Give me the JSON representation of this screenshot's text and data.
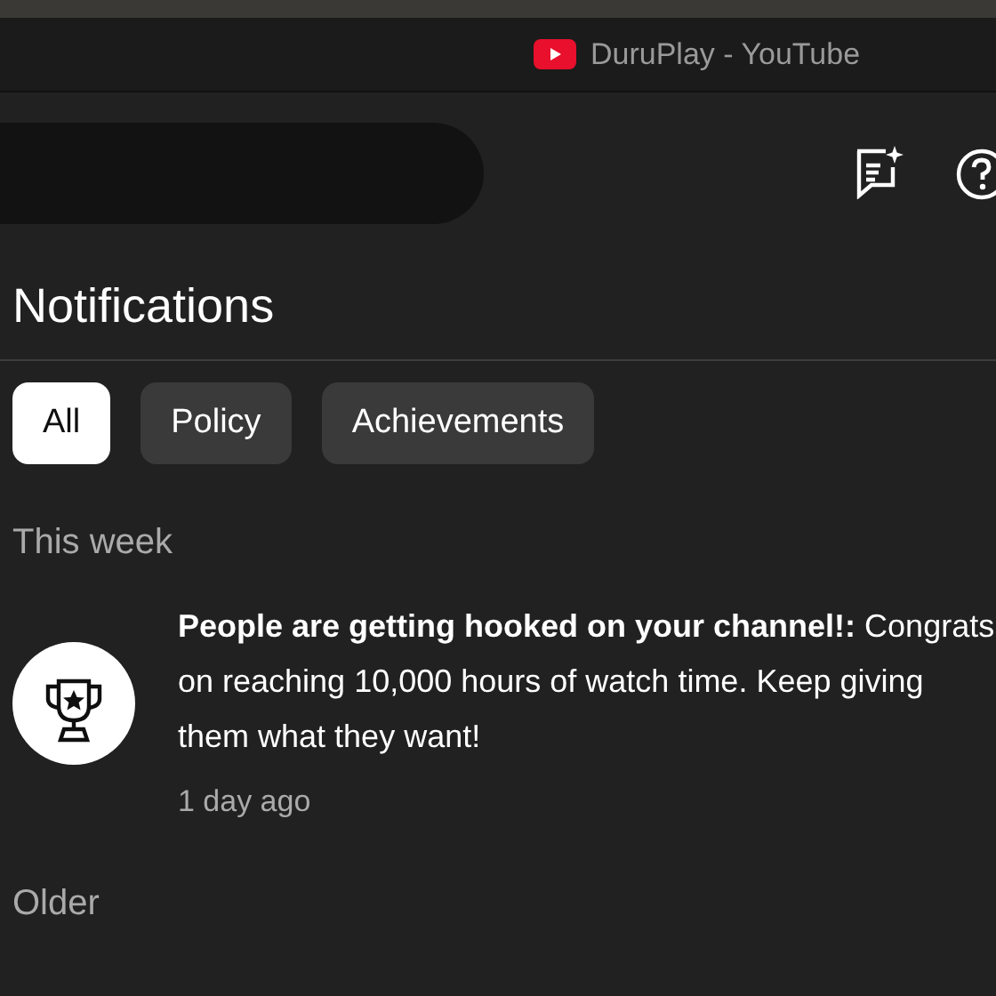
{
  "window": {
    "title": "DuruPlay - YouTube"
  },
  "heading": "Notifications",
  "filters": [
    {
      "label": "All",
      "selected": true
    },
    {
      "label": "Policy",
      "selected": false
    },
    {
      "label": "Achievements",
      "selected": false
    }
  ],
  "sections": [
    {
      "title": "This week",
      "notifications": [
        {
          "message": "**People are getting hooked on your channel!:** Congrats on reaching 10,000 hours of watch time. Keep giving them what they want!",
          "time": "1 day ago"
        }
      ]
    },
    {
      "title": "Older"
    }
  ]
}
